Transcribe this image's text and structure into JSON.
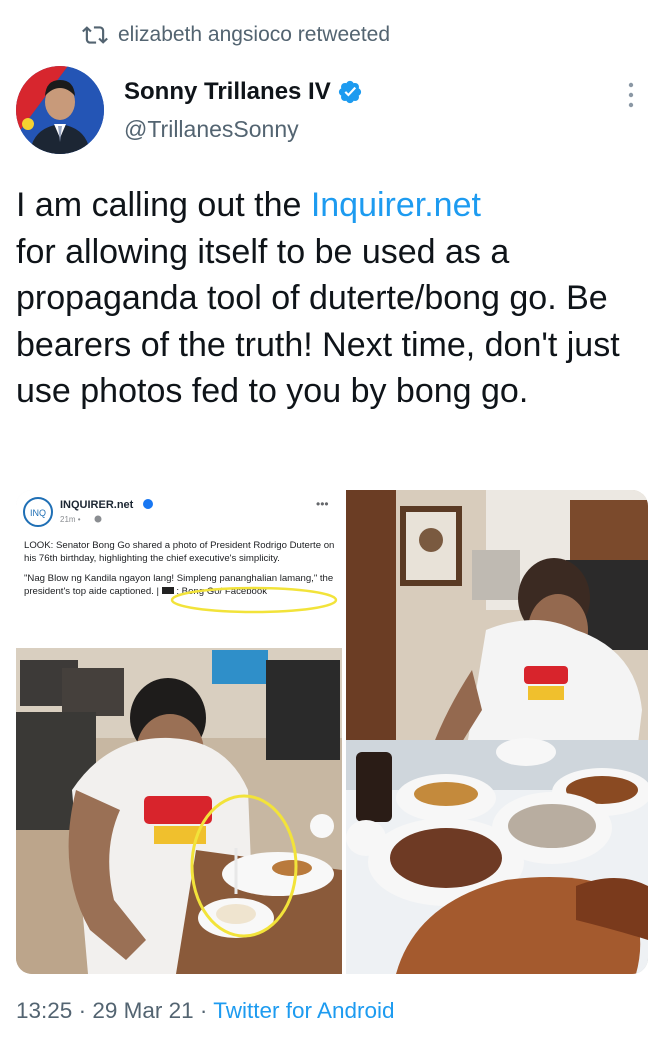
{
  "retweet": {
    "label": "elizabeth angsioco retweeted"
  },
  "author": {
    "name": "Sonny Trillanes IV",
    "handle": "@TrillanesSonny"
  },
  "tweet": {
    "text_before_link": "I am calling out the ",
    "link_text": "Inquirer.net",
    "text_after_link": "for allowing itself to be used as a propaganda tool of duterte/bong go. Be bearers of the truth! Next time, don't just use photos fed to you by bong go."
  },
  "media": {
    "embedded_post": {
      "account": "INQUIRER.net",
      "logo_text": "INQ",
      "meta": "21m •",
      "caption_1": "LOOK: Senator Bong Go shared a photo of President Rodrigo Duterte on his 76th birthday, highlighting the chief executive's simplicity.",
      "caption_2": "\"Nag Blow ng Kandila ngayon lang! Simpleng pananghalian lamang,\" the president's top aide captioned. |",
      "caption_credit": ": Bong Go/ Facebook"
    }
  },
  "footer": {
    "time": "13:25",
    "sep1": " · ",
    "date": "29 Mar 21",
    "sep2": " · ",
    "source": "Twitter for Android"
  },
  "colors": {
    "accent": "#1d9bf0",
    "secondary_text": "#536471",
    "highlight_circle": "#f2e33a"
  },
  "icons": [
    "retweet-icon",
    "verified-badge-icon",
    "more-options-icon",
    "globe-icon"
  ]
}
